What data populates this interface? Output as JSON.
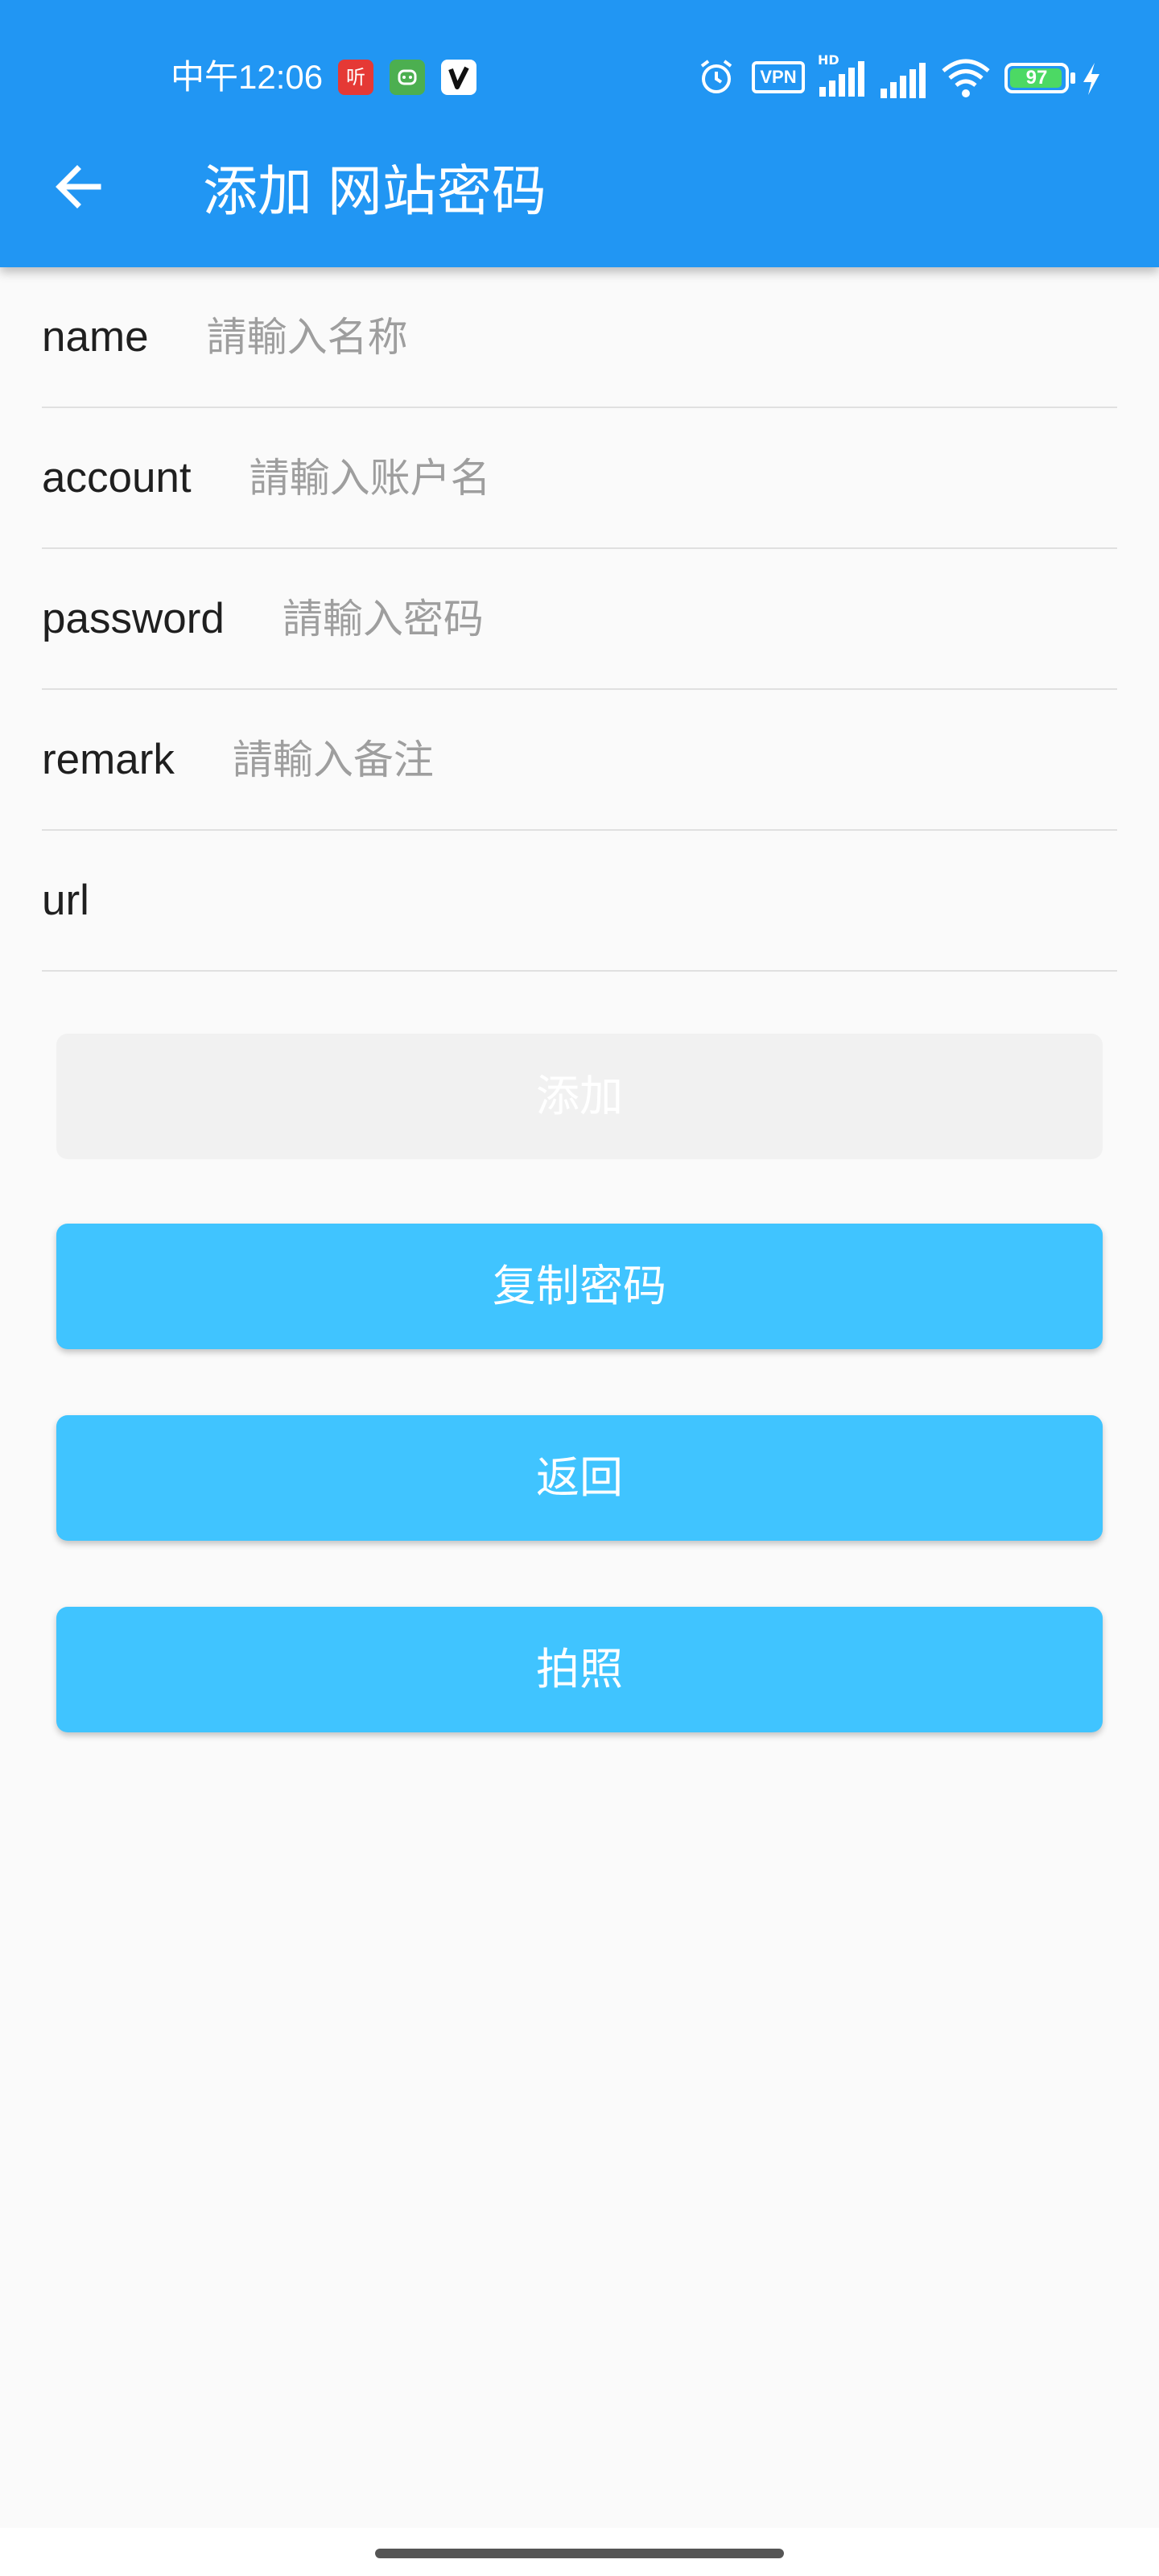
{
  "status_bar": {
    "time": "中午12:06",
    "vpn": "VPN",
    "network": "HD",
    "battery": "97",
    "battery_level": 0.97,
    "icons": [
      "ting-app-icon",
      "android-robot-icon",
      "v-app-icon",
      "alarm-icon",
      "vpn-icon",
      "signal-icon",
      "signal-icon",
      "wifi-icon",
      "battery-icon",
      "charging-icon"
    ]
  },
  "toolbar": {
    "title": "添加 网站密码",
    "back_icon": "arrow-left-icon"
  },
  "form": {
    "fields": [
      {
        "label": "name",
        "value": "",
        "placeholder": "請輸入名称"
      },
      {
        "label": "account",
        "value": "",
        "placeholder": "請輸入账户名"
      },
      {
        "label": "password",
        "value": "",
        "placeholder": "請輸入密码"
      },
      {
        "label": "remark",
        "value": "",
        "placeholder": "請輸入备注"
      },
      {
        "label": "url",
        "value": "",
        "placeholder": ""
      }
    ]
  },
  "buttons": {
    "add": "添加",
    "copy_password": "复制密码",
    "back": "返回",
    "photo": "拍照"
  },
  "colors": {
    "appbar": "#2196f3",
    "button": "#40c4ff",
    "disabled_button": "#f1f1f1",
    "background": "#fafafa"
  }
}
